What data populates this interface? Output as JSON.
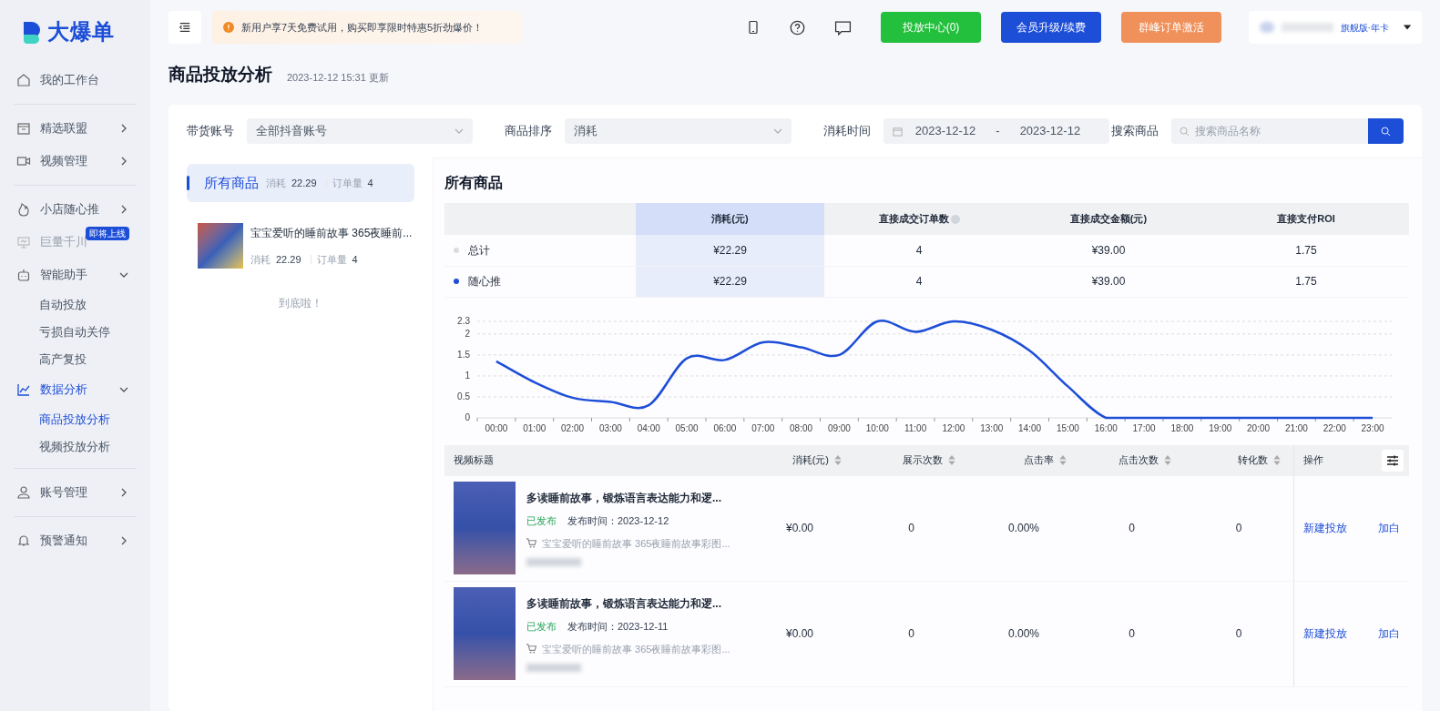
{
  "logo": {
    "text": "大爆单"
  },
  "sidebar": {
    "groups": [
      [
        {
          "label": "我的工作台",
          "selected": false
        }
      ],
      [
        {
          "label": "精选联盟",
          "selected": false,
          "expanded": false
        },
        {
          "label": "视频管理",
          "selected": false,
          "expanded": false
        }
      ],
      [
        {
          "label": "小店随心推",
          "selected": false,
          "expanded": false
        },
        {
          "label": "巨量千川",
          "selected": false,
          "disabled": true,
          "badge": "即将上线"
        },
        {
          "label": "智能助手",
          "selected": false,
          "expanded": true,
          "children": [
            {
              "label": "自动投放",
              "selected": false
            },
            {
              "label": "亏损自动关停",
              "selected": false
            },
            {
              "label": "高产复投",
              "selected": false
            }
          ]
        },
        {
          "label": "数据分析",
          "selected": true,
          "expanded": true,
          "children": [
            {
              "label": "商品投放分析",
              "selected": true
            },
            {
              "label": "视频投放分析",
              "selected": false
            }
          ]
        }
      ],
      [
        {
          "label": "账号管理",
          "selected": false,
          "expanded": false
        }
      ],
      [
        {
          "label": "预警通知",
          "selected": false,
          "expanded": false
        }
      ]
    ]
  },
  "header": {
    "notice": "新用户享7天免费试用，购买即享限时特惠5折劲爆价！",
    "buttons": [
      {
        "label": "投放中心(0)",
        "color": "#22c03c"
      },
      {
        "label": "会员升级/续费",
        "color": "#1d4ed8"
      },
      {
        "label": "群峰订单激活",
        "color": "#f0905a"
      }
    ],
    "user": {
      "plan": "旗舰版·年卡"
    }
  },
  "page": {
    "title": "商品投放分析",
    "updated": "2023-12-12 15:31 更新"
  },
  "filters": {
    "account": {
      "label": "带货账号",
      "value": "全部抖音账号"
    },
    "sort": {
      "label": "商品排序",
      "value": "消耗"
    },
    "date": {
      "label": "消耗时间",
      "start": "2023-12-12",
      "separator": "-",
      "end": "2023-12-12"
    },
    "search": {
      "label": "搜索商品",
      "placeholder": "搜索商品名称"
    }
  },
  "product_list": {
    "items": [
      {
        "kind": "all",
        "title": "所有商品",
        "selected": true,
        "stats": [
          {
            "label": "消耗",
            "value": "22.29"
          },
          {
            "label": "订单量",
            "value": "4"
          }
        ]
      },
      {
        "kind": "product",
        "title": "宝宝爱听的睡前故事 365夜睡前...",
        "selected": false,
        "stats": [
          {
            "label": "消耗",
            "value": "22.29"
          },
          {
            "label": "订单量",
            "value": "4"
          }
        ]
      }
    ],
    "end_note": "到底啦！"
  },
  "detail": {
    "title": "所有商品",
    "summary": {
      "columns": [
        {
          "label": "消耗(元)",
          "selected": true
        },
        {
          "label": "直接成交订单数",
          "selected": false,
          "info": true
        },
        {
          "label": "直接成交金额(元)",
          "selected": false
        },
        {
          "label": "直接支付ROI",
          "selected": false
        }
      ],
      "rows": [
        {
          "label": "总计",
          "color": "#dcdcdc",
          "cells": [
            "¥22.29",
            "4",
            "¥39.00",
            "1.75"
          ]
        },
        {
          "label": "随心推",
          "color": "#1d4ed8",
          "cells": [
            "¥22.29",
            "4",
            "¥39.00",
            "1.75"
          ]
        }
      ]
    },
    "chart_data": {
      "type": "line",
      "categories": [
        "00:00",
        "01:00",
        "02:00",
        "03:00",
        "04:00",
        "05:00",
        "06:00",
        "07:00",
        "08:00",
        "09:00",
        "10:00",
        "11:00",
        "12:00",
        "13:00",
        "14:00",
        "15:00",
        "16:00",
        "17:00",
        "18:00",
        "19:00",
        "20:00",
        "21:00",
        "22:00",
        "23:00"
      ],
      "grid": true,
      "series": [
        {
          "color": "#1d4ed8",
          "values": [
            1.35,
            0.85,
            0.48,
            0.38,
            0.3,
            1.42,
            1.38,
            1.8,
            1.68,
            1.5,
            2.3,
            2.05,
            2.3,
            2.1,
            1.6,
            0.75,
            0,
            0,
            0,
            0,
            0,
            0,
            0,
            0
          ]
        }
      ],
      "ylim": [
        0,
        2.3
      ],
      "yticks": [
        0,
        0.5,
        1,
        1.5,
        2,
        2.3
      ]
    },
    "videos": {
      "title_column": {
        "label": "视频标题"
      },
      "columns": [
        {
          "label": "消耗(元)",
          "sortable": true
        },
        {
          "label": "展示次数",
          "sortable": true
        },
        {
          "label": "点击率",
          "sortable": true
        },
        {
          "label": "点击次数",
          "sortable": true
        },
        {
          "label": "转化数",
          "sortable": true
        }
      ],
      "actions_column": {
        "label": "操作"
      },
      "rows": [
        {
          "title": "多读睡前故事，锻炼语言表达能力和逻...",
          "status": "已发布",
          "published": "发布时间：2023-12-12",
          "product": "宝宝爱听的睡前故事 365夜睡前故事彩图...",
          "cells": [
            "¥0.00",
            "0",
            "0.00%",
            "0",
            "0"
          ],
          "actions": [
            "新建投放",
            "加白"
          ]
        },
        {
          "title": "多读睡前故事，锻炼语言表达能力和逻...",
          "status": "已发布",
          "published": "发布时间：2023-12-11",
          "product": "宝宝爱听的睡前故事 365夜睡前故事彩图...",
          "cells": [
            "¥0.00",
            "0",
            "0.00%",
            "0",
            "0"
          ],
          "actions": [
            "新建投放",
            "加白"
          ]
        }
      ]
    }
  }
}
